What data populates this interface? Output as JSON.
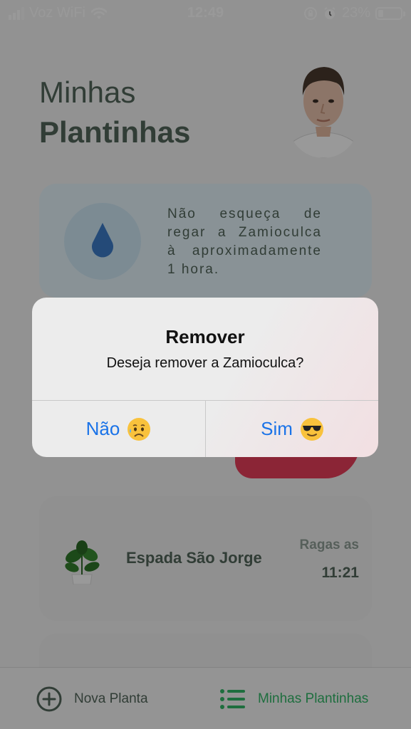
{
  "status_bar": {
    "carrier": "Voz WiFi",
    "time": "12:49",
    "battery_percent": "23%",
    "battery_level": 0.23
  },
  "header": {
    "title_line1": "Minhas",
    "title_line2": "Plantinhas"
  },
  "tip": {
    "text": "Não esqueça de regar a Zamioculca à aproximadamente 1 hora."
  },
  "plant": {
    "name": "Espada São Jorge",
    "water_label": "Ragas as",
    "water_time": "11:21"
  },
  "tab_bar": {
    "new_plant": "Nova Planta",
    "my_plants": "Minhas Plantinhas"
  },
  "alert": {
    "title": "Remover",
    "message": "Deseja remover a Zamioculca?",
    "no_label": "Não",
    "yes_label": "Sim"
  },
  "colors": {
    "accent_green": "#32b768",
    "heading": "#52665a",
    "remove_red": "#e83f5b",
    "ios_blue": "#1a73e8"
  }
}
